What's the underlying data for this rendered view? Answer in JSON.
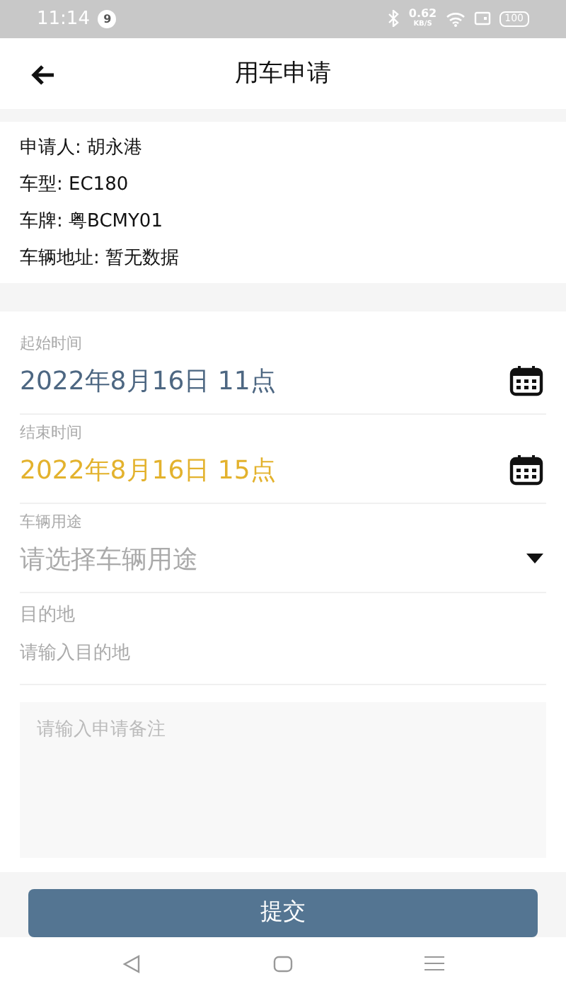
{
  "status_bar": {
    "time": "11:14",
    "notification_badge": "9",
    "net_speed": "0.62",
    "net_unit": "KB/S",
    "battery": "100"
  },
  "header": {
    "title": "用车申请"
  },
  "info": [
    "申请人: 胡永港",
    "车型: EC180",
    "车牌: 粤BCMY01",
    "车辆地址: 暂无数据"
  ],
  "fields": [
    {
      "kind": "date",
      "label": "起始时间",
      "value": "2022年8月16日  11点",
      "color": "#4d6782"
    },
    {
      "kind": "date",
      "label": "结束时间",
      "value": "2022年8月16日  15点",
      "color": "#e3b22d"
    },
    {
      "kind": "select",
      "label": "车辆用途",
      "placeholder": "请选择车辆用途"
    },
    {
      "kind": "input",
      "label": "目的地",
      "placeholder": "请输入目的地"
    }
  ],
  "remarks": {
    "placeholder": "请输入申请备注"
  },
  "submit": {
    "label": "提交"
  }
}
